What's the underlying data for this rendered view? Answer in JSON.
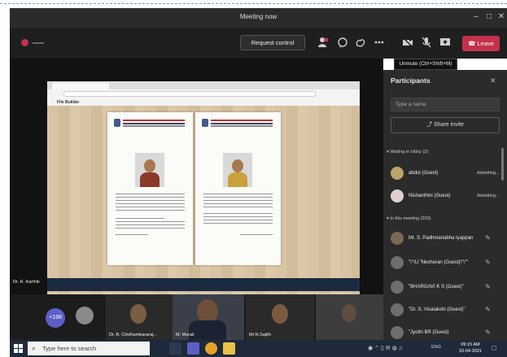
{
  "window": {
    "title": "Meeting now",
    "controls": [
      "–",
      "□",
      "✕"
    ]
  },
  "toolbar": {
    "request_control": "Request control",
    "leave": "Leave"
  },
  "tooltip": "Unmute (Ctrl+Shift+M)",
  "participants": {
    "title": "Participants",
    "search_placeholder": "Type a name",
    "share_invite": "Share invite",
    "waiting_header": "Waiting in lobby (2)",
    "waiting": [
      {
        "name": "abdul (Guest)",
        "status": "Admitting..."
      },
      {
        "name": "Nishanthini (Guest)",
        "status": "Admitting..."
      }
    ],
    "in_meeting_header": "In this meeting (203)",
    "members": [
      {
        "name": "Mr. S. Padhmanabha Iyappan"
      },
      {
        "name": "\"\\\"\\U.\"Nesheran (Guest)\\\"\\\"\""
      },
      {
        "name": "\"BHARGAVI K S (Guest)\""
      },
      {
        "name": "\"Dr. S. Visalakshi (Guest)\""
      },
      {
        "name": "\"Jyothi BR (Guest)"
      }
    ]
  },
  "stage": {
    "presenter_label": "Dr. R. Karthik",
    "app_title": "File Builder"
  },
  "strip": {
    "more_count": "+198",
    "tiles": [
      "Dr. B. Chidhambararaj...",
      "M. Murali",
      "Mr.N.Sajith"
    ]
  },
  "taskbar": {
    "search_placeholder": "Type here to search",
    "lang": "ENG",
    "time": "09:15 AM",
    "date": "10-04-2021"
  },
  "colors": {
    "leave": "#c4314b",
    "accent": "#5b5fc7",
    "panel": "#2b2b2b"
  }
}
